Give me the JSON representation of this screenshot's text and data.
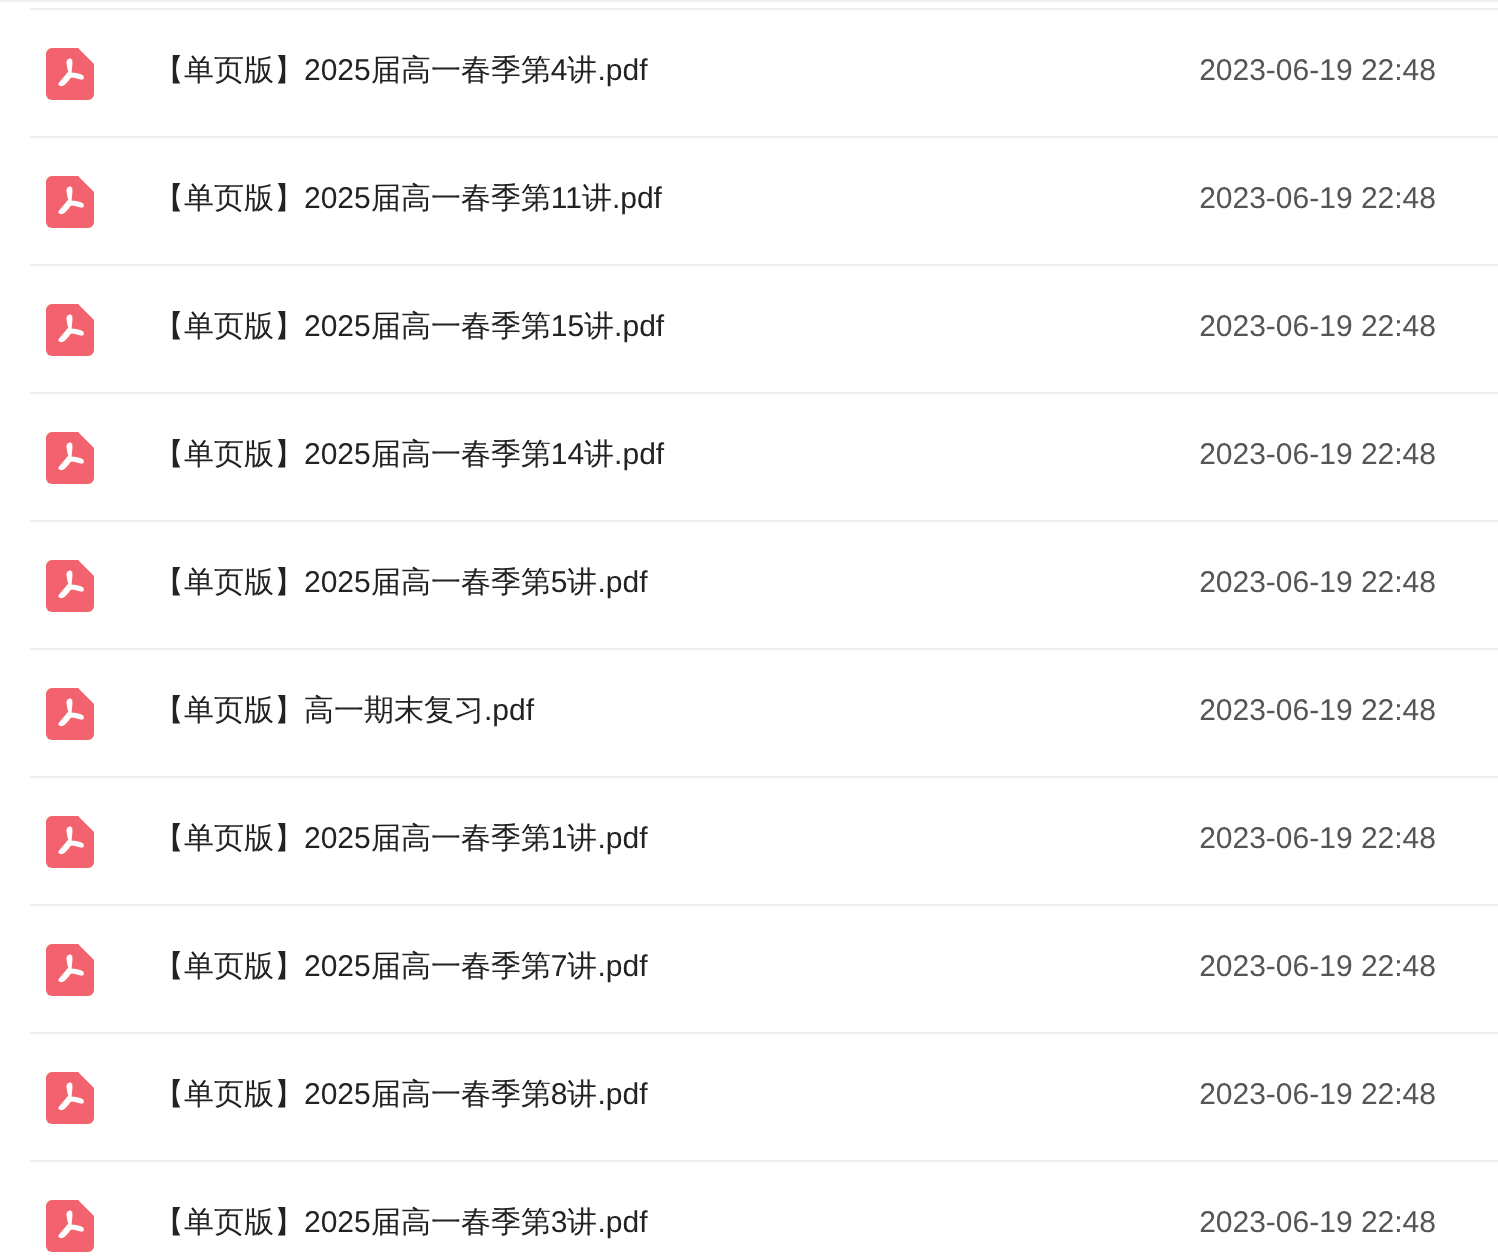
{
  "files": [
    {
      "name": "【单页版】2025届高一春季第4讲.pdf",
      "date": "2023-06-19 22:48"
    },
    {
      "name": "【单页版】2025届高一春季第11讲.pdf",
      "date": "2023-06-19 22:48"
    },
    {
      "name": "【单页版】2025届高一春季第15讲.pdf",
      "date": "2023-06-19 22:48"
    },
    {
      "name": "【单页版】2025届高一春季第14讲.pdf",
      "date": "2023-06-19 22:48"
    },
    {
      "name": "【单页版】2025届高一春季第5讲.pdf",
      "date": "2023-06-19 22:48"
    },
    {
      "name": "【单页版】高一期末复习.pdf",
      "date": "2023-06-19 22:48"
    },
    {
      "name": "【单页版】2025届高一春季第1讲.pdf",
      "date": "2023-06-19 22:48"
    },
    {
      "name": "【单页版】2025届高一春季第7讲.pdf",
      "date": "2023-06-19 22:48"
    },
    {
      "name": "【单页版】2025届高一春季第8讲.pdf",
      "date": "2023-06-19 22:48"
    },
    {
      "name": "【单页版】2025届高一春季第3讲.pdf",
      "date": "2023-06-19 22:48"
    }
  ]
}
